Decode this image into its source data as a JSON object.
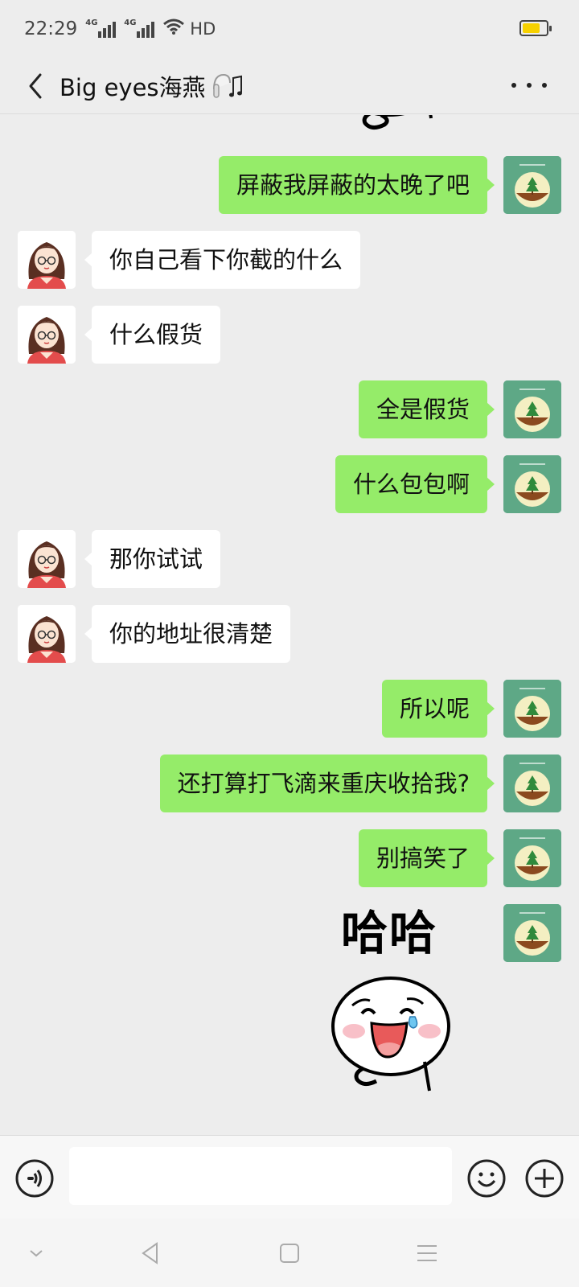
{
  "status_bar": {
    "time": "22:29",
    "signal_tag_1": "4G",
    "signal_tag_2": "4G",
    "hd": "HD",
    "battery_level": 0.65,
    "battery_color": "#f7d100"
  },
  "nav": {
    "title": "Big eyes海燕",
    "title_icon": "earphone-music-icon",
    "back_icon": "chevron-left-icon",
    "more_icon": "more-dots-icon"
  },
  "messages": [
    {
      "side": "out",
      "text": "屏蔽我屏蔽的太晚了吧"
    },
    {
      "side": "in",
      "text": "你自己看下你截的什么"
    },
    {
      "side": "in",
      "text": "什么假货"
    },
    {
      "side": "out",
      "text": "全是假货"
    },
    {
      "side": "out",
      "text": "什么包包啊"
    },
    {
      "side": "in",
      "text": "那你试试"
    },
    {
      "side": "in",
      "text": "你的地址很清楚"
    },
    {
      "side": "out",
      "text": "所以呢"
    },
    {
      "side": "out",
      "text": "还打算打飞滴来重庆收拾我?"
    },
    {
      "side": "out",
      "text": "别搞笑了"
    },
    {
      "side": "out",
      "sticker_text": "哈哈",
      "sticker": "laughing-crying-face-sticker"
    }
  ],
  "input_bar": {
    "voice_icon": "voice-icon",
    "emoji_icon": "smiley-icon",
    "plus_icon": "plus-circle-icon"
  },
  "colors": {
    "out_bubble": "#95ec69",
    "in_bubble": "#ffffff",
    "background": "#ededed"
  }
}
